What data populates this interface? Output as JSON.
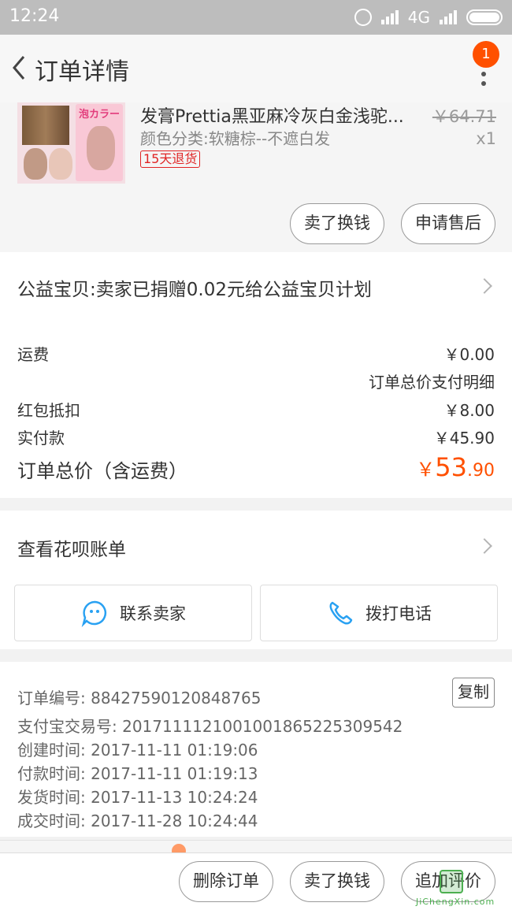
{
  "status_bar": {
    "time": "12:24",
    "network": "4G"
  },
  "header": {
    "title": "订单详情",
    "notification_count": "1"
  },
  "product": {
    "name": "发膏Prettia黑亚麻冷灰白金浅驼...",
    "spec": "颜色分类:软糖棕--不遮白发",
    "return_tag": "15天退货",
    "original_price": "￥64.71",
    "quantity": "x1",
    "image_text": "泡カラー",
    "buttons": {
      "sell": "卖了换钱",
      "after_sale": "申请售后"
    }
  },
  "donation": {
    "text": "公益宝贝:卖家已捐赠0.02元给公益宝贝计划"
  },
  "fees": {
    "shipping_label": "运费",
    "shipping_value": "￥0.00",
    "payment_detail_link": "订单总价支付明细",
    "red_packet_label": "红包抵扣",
    "red_packet_value": "￥8.00",
    "paid_label": "实付款",
    "paid_value": "￥45.90",
    "total_label": "订单总价（含运费）",
    "total_currency": "￥",
    "total_integer": "53",
    "total_decimal": ".90"
  },
  "huabei": {
    "text": "查看花呗账单",
    "contact_seller": "联系卖家",
    "call_phone": "拨打电话"
  },
  "order_info": {
    "order_no": "订单编号: 884275901208487​65",
    "copy_label": "复制",
    "alipay_no": "支付宝交易号: 2017111121001001865225309542",
    "created": "创建时间: 2017-11-11 01:19:06",
    "paid": "付款时间: 2017-11-11 01:19:13",
    "shipped": "发货时间: 2017-11-13 10:24:24",
    "completed": "成交时间: 2017-11-28 10:24:44"
  },
  "bottom_bar": {
    "delete": "删除订单",
    "sell": "卖了换钱",
    "review": "追加评价"
  },
  "watermark": {
    "text": "JiChengXin.com"
  },
  "colors": {
    "accent": "#ff5000",
    "status_bar": "#bdbdbd"
  }
}
